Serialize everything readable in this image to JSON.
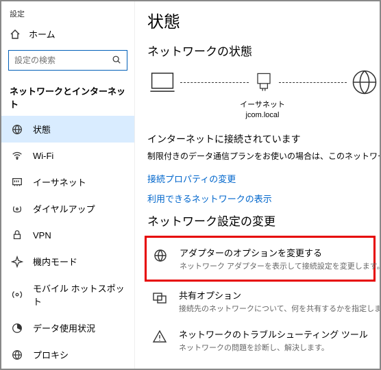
{
  "app_title": "設定",
  "home_label": "ホーム",
  "search_placeholder": "設定の検索",
  "sidebar_section": "ネットワークとインターネット",
  "nav": [
    {
      "label": "状態"
    },
    {
      "label": "Wi-Fi"
    },
    {
      "label": "イーサネット"
    },
    {
      "label": "ダイヤルアップ"
    },
    {
      "label": "VPN"
    },
    {
      "label": "機内モード"
    },
    {
      "label": "モバイル ホットスポット"
    },
    {
      "label": "データ使用状況"
    },
    {
      "label": "プロキシ"
    }
  ],
  "page_title": "状態",
  "subheading": "ネットワークの状態",
  "diagram": {
    "mid_label1": "イーサネット",
    "mid_label2": "jcom.local"
  },
  "connected_text": "インターネットに接続されています",
  "connected_body": "制限付きのデータ通信プランをお使いの場合は、このネットワークを従量制課金接続に設定するか、またはその他のプロパティを変更できます。",
  "link1": "接続プロパティの変更",
  "link2": "利用できるネットワークの表示",
  "section2": "ネットワーク設定の変更",
  "options": [
    {
      "title": "アダプターのオプションを変更する",
      "desc": "ネットワーク アダプターを表示して接続設定を変更します。"
    },
    {
      "title": "共有オプション",
      "desc": "接続先のネットワークについて、何を共有するかを指定します。"
    },
    {
      "title": "ネットワークのトラブルシューティング ツール",
      "desc": "ネットワークの問題を診断し、解決します。"
    }
  ]
}
